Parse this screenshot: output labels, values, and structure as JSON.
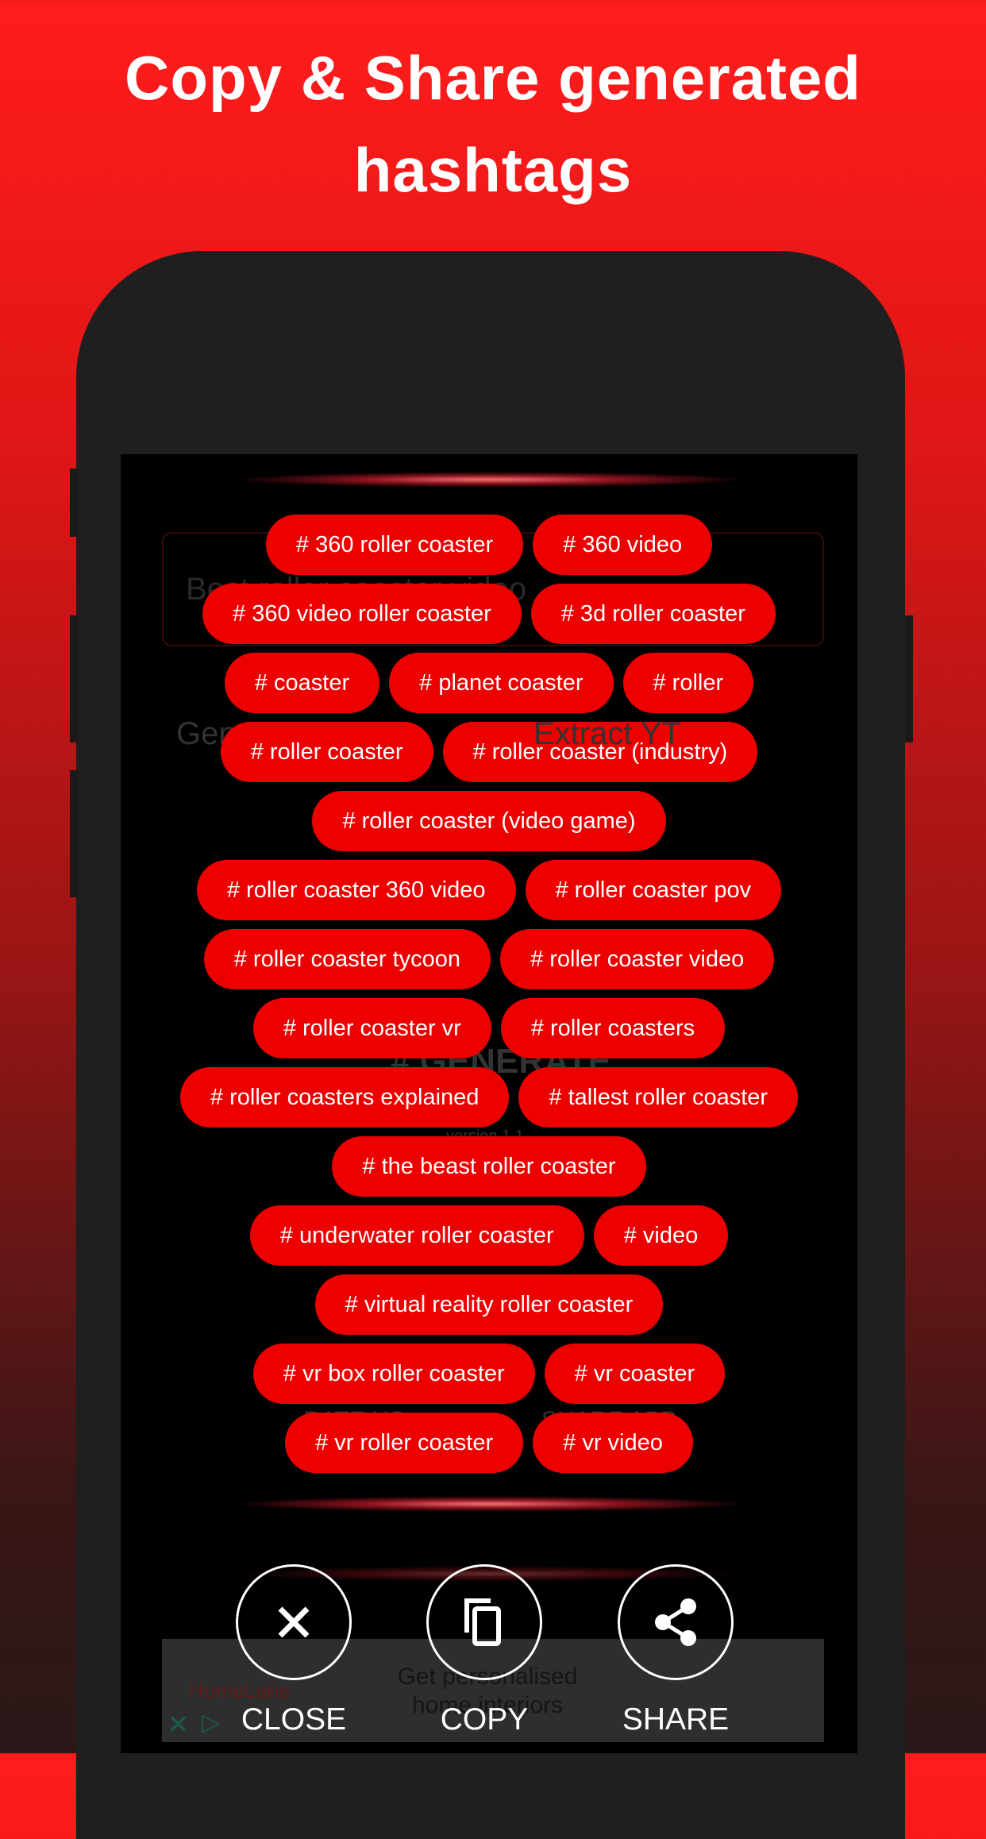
{
  "headline": {
    "line1": "Copy & Share generated",
    "line2": "hashtags"
  },
  "background_app": {
    "input_value": "Best roller coaster video",
    "radio_1": "Generate YT",
    "radio_2": "Extract YT",
    "generate_label": "# GENERATE",
    "version": "version 1.1",
    "rate_us": "RATE US",
    "share_app": "SHARE APP"
  },
  "hashtag_rows": [
    [
      "# 360 roller coaster",
      "# 360 video"
    ],
    [
      "# 360 video roller coaster",
      "# 3d roller coaster"
    ],
    [
      "# coaster",
      "# planet coaster",
      "# roller"
    ],
    [
      "# roller coaster",
      "# roller coaster (industry)"
    ],
    [
      "# roller coaster (video game)"
    ],
    [
      "# roller coaster 360 video",
      "# roller coaster pov"
    ],
    [
      "# roller coaster tycoon",
      "# roller coaster video"
    ],
    [
      "# roller coaster vr",
      "# roller coasters"
    ],
    [
      "# roller coasters explained",
      "# tallest roller coaster"
    ],
    [
      "# the beast roller coaster"
    ],
    [
      "# underwater roller coaster",
      "# video"
    ],
    [
      "# virtual reality roller coaster"
    ],
    [
      "# vr box roller coaster",
      "# vr coaster"
    ],
    [
      "# vr roller coaster",
      "# vr video"
    ]
  ],
  "actions": {
    "close": "CLOSE",
    "copy": "COPY",
    "share": "SHARE"
  },
  "ad": {
    "brand": "HomeLane",
    "text": "Get personalised home interiors"
  },
  "colors": {
    "chip": "#ec0000",
    "accent": "#ff1c1c"
  }
}
